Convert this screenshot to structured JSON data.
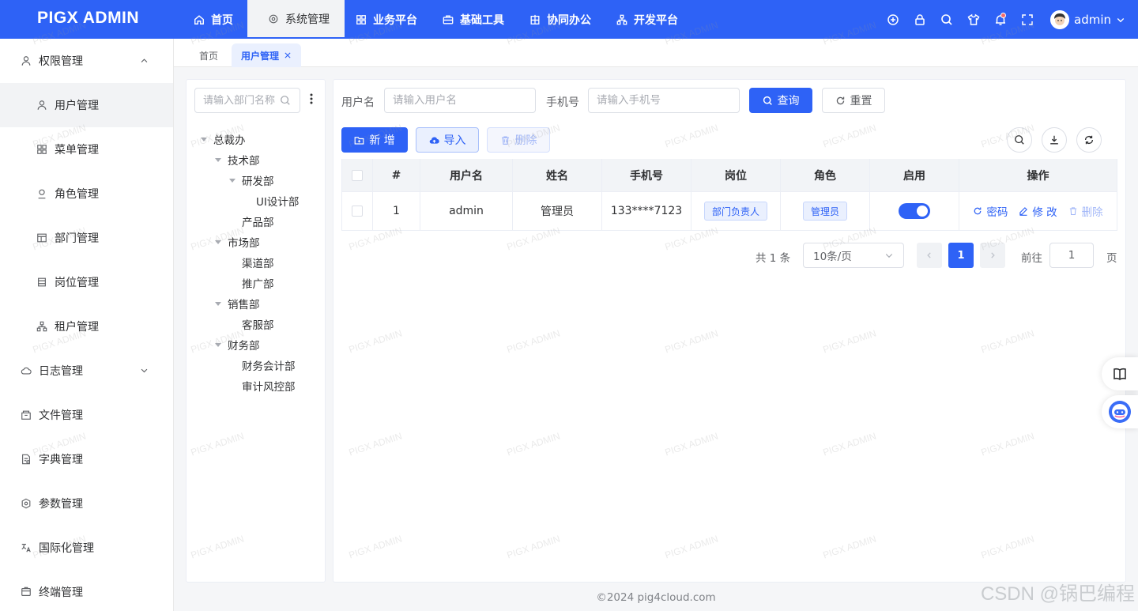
{
  "app": {
    "logo": "PIGX ADMIN"
  },
  "topnav": [
    {
      "label": "首页",
      "icon": "home-icon",
      "active": false
    },
    {
      "label": "系统管理",
      "icon": "settings-icon",
      "active": true
    },
    {
      "label": "业务平台",
      "icon": "grid-icon",
      "active": false
    },
    {
      "label": "基础工具",
      "icon": "briefcase-icon",
      "active": false
    },
    {
      "label": "协同办公",
      "icon": "building-icon",
      "active": false
    },
    {
      "label": "开发平台",
      "icon": "org-tree-icon",
      "active": false
    }
  ],
  "header_tools": [
    "add-circle-icon",
    "lock-icon",
    "search-icon",
    "theme-shirt-icon",
    "bell-icon",
    "fullscreen-icon"
  ],
  "user": {
    "name": "admin"
  },
  "sidebar": {
    "items": [
      {
        "label": "权限管理",
        "icon": "user-icon",
        "level": 0,
        "expanded": true
      },
      {
        "label": "用户管理",
        "icon": "user-icon",
        "level": 1,
        "active": true
      },
      {
        "label": "菜单管理",
        "icon": "menu-grid-icon",
        "level": 1
      },
      {
        "label": "角色管理",
        "icon": "role-icon",
        "level": 1
      },
      {
        "label": "部门管理",
        "icon": "dept-icon",
        "level": 1
      },
      {
        "label": "岗位管理",
        "icon": "post-icon",
        "level": 1
      },
      {
        "label": "租户管理",
        "icon": "tenant-icon",
        "level": 1
      },
      {
        "label": "日志管理",
        "icon": "cloud-icon",
        "level": 0,
        "expanded": false
      },
      {
        "label": "文件管理",
        "icon": "file-box-icon",
        "level": 0
      },
      {
        "label": "字典管理",
        "icon": "dict-icon",
        "level": 0
      },
      {
        "label": "参数管理",
        "icon": "param-icon",
        "level": 0
      },
      {
        "label": "国际化管理",
        "icon": "i18n-icon",
        "level": 0
      },
      {
        "label": "终端管理",
        "icon": "terminal-icon",
        "level": 0
      }
    ]
  },
  "tabs": [
    {
      "label": "首页",
      "active": false
    },
    {
      "label": "用户管理",
      "active": true
    }
  ],
  "tree": {
    "search_placeholder": "请输入部门名称",
    "nodes": [
      {
        "label": "总裁办",
        "depth": 0,
        "caret": true
      },
      {
        "label": "技术部",
        "depth": 1,
        "caret": true
      },
      {
        "label": "研发部",
        "depth": 2,
        "caret": true
      },
      {
        "label": "UI设计部",
        "depth": 3,
        "caret": false
      },
      {
        "label": "产品部",
        "depth": 2,
        "caret": false
      },
      {
        "label": "市场部",
        "depth": 1,
        "caret": true
      },
      {
        "label": "渠道部",
        "depth": 2,
        "caret": false
      },
      {
        "label": "推广部",
        "depth": 2,
        "caret": false
      },
      {
        "label": "销售部",
        "depth": 1,
        "caret": true
      },
      {
        "label": "客服部",
        "depth": 2,
        "caret": false
      },
      {
        "label": "财务部",
        "depth": 1,
        "caret": true
      },
      {
        "label": "财务会计部",
        "depth": 2,
        "caret": false
      },
      {
        "label": "审计风控部",
        "depth": 2,
        "caret": false
      }
    ]
  },
  "filters": {
    "username_label": "用户名",
    "username_placeholder": "请输入用户名",
    "phone_label": "手机号",
    "phone_placeholder": "请输入手机号",
    "query_label": "查询",
    "reset_label": "重置"
  },
  "actions": {
    "add_label": "新 增",
    "import_label": "导入",
    "delete_label": "删除"
  },
  "table": {
    "columns": [
      "",
      "#",
      "用户名",
      "姓名",
      "手机号",
      "岗位",
      "角色",
      "启用",
      "操作"
    ],
    "rows": [
      {
        "index": "1",
        "username": "admin",
        "name": "管理员",
        "phone": "133****7123",
        "post": "部门负责人",
        "role": "管理员",
        "enabled": true,
        "ops": {
          "password": "密码",
          "edit": "修 改",
          "delete": "删除"
        }
      }
    ]
  },
  "pagination": {
    "total_text": "共 1 条",
    "page_size": "10条/页",
    "current": "1",
    "goto_label": "前往",
    "goto_value": "1",
    "page_unit": "页"
  },
  "footer": "©2024 pig4cloud.com",
  "watermark": "PIGX ADMIN",
  "corner_mark": "CSDN @锅巴编程",
  "colors": {
    "primary": "#2e62f6",
    "header_bg": "#2e62f6",
    "page_bg": "#f5f6f8"
  }
}
